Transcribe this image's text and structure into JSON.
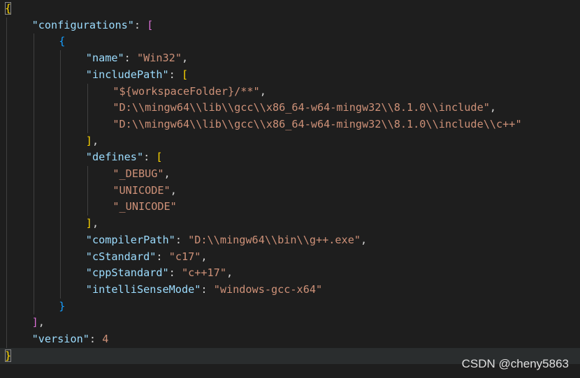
{
  "editor": {
    "lines": [
      {
        "indent": 0,
        "tokens": [
          {
            "t": "{",
            "c": "tok-bracket-y",
            "match": true
          }
        ]
      },
      {
        "indent": 1,
        "tokens": [
          {
            "t": "\"configurations\"",
            "c": "tok-key"
          },
          {
            "t": ": ",
            "c": "tok-punct"
          },
          {
            "t": "[",
            "c": "tok-bracket-p"
          }
        ]
      },
      {
        "indent": 2,
        "tokens": [
          {
            "t": "{",
            "c": "tok-bracket-b"
          }
        ]
      },
      {
        "indent": 3,
        "tokens": [
          {
            "t": "\"name\"",
            "c": "tok-key"
          },
          {
            "t": ": ",
            "c": "tok-punct"
          },
          {
            "t": "\"Win32\"",
            "c": "tok-str"
          },
          {
            "t": ",",
            "c": "tok-punct"
          }
        ]
      },
      {
        "indent": 3,
        "tokens": [
          {
            "t": "\"includePath\"",
            "c": "tok-key"
          },
          {
            "t": ": ",
            "c": "tok-punct"
          },
          {
            "t": "[",
            "c": "tok-bracket-y"
          }
        ]
      },
      {
        "indent": 4,
        "tokens": [
          {
            "t": "\"${workspaceFolder}/**\"",
            "c": "tok-str"
          },
          {
            "t": ",",
            "c": "tok-punct"
          }
        ]
      },
      {
        "indent": 4,
        "tokens": [
          {
            "t": "\"D:\\\\mingw64\\\\lib\\\\gcc\\\\x86_64-w64-mingw32\\\\8.1.0\\\\include\"",
            "c": "tok-str"
          },
          {
            "t": ",",
            "c": "tok-punct"
          }
        ]
      },
      {
        "indent": 4,
        "tokens": [
          {
            "t": "\"D:\\\\mingw64\\\\lib\\\\gcc\\\\x86_64-w64-mingw32\\\\8.1.0\\\\include\\\\c++\"",
            "c": "tok-str"
          }
        ]
      },
      {
        "indent": 3,
        "tokens": [
          {
            "t": "]",
            "c": "tok-bracket-y"
          },
          {
            "t": ",",
            "c": "tok-punct"
          }
        ]
      },
      {
        "indent": 3,
        "tokens": [
          {
            "t": "\"defines\"",
            "c": "tok-key"
          },
          {
            "t": ": ",
            "c": "tok-punct"
          },
          {
            "t": "[",
            "c": "tok-bracket-y"
          }
        ]
      },
      {
        "indent": 4,
        "tokens": [
          {
            "t": "\"_DEBUG\"",
            "c": "tok-str"
          },
          {
            "t": ",",
            "c": "tok-punct"
          }
        ]
      },
      {
        "indent": 4,
        "tokens": [
          {
            "t": "\"UNICODE\"",
            "c": "tok-str"
          },
          {
            "t": ",",
            "c": "tok-punct"
          }
        ]
      },
      {
        "indent": 4,
        "tokens": [
          {
            "t": "\"_UNICODE\"",
            "c": "tok-str"
          }
        ]
      },
      {
        "indent": 3,
        "tokens": [
          {
            "t": "]",
            "c": "tok-bracket-y"
          },
          {
            "t": ",",
            "c": "tok-punct"
          }
        ]
      },
      {
        "indent": 3,
        "tokens": [
          {
            "t": "\"compilerPath\"",
            "c": "tok-key"
          },
          {
            "t": ": ",
            "c": "tok-punct"
          },
          {
            "t": "\"D:\\\\mingw64\\\\bin\\\\g++.exe\"",
            "c": "tok-str"
          },
          {
            "t": ",",
            "c": "tok-punct"
          }
        ]
      },
      {
        "indent": 3,
        "tokens": [
          {
            "t": "\"cStandard\"",
            "c": "tok-key"
          },
          {
            "t": ": ",
            "c": "tok-punct"
          },
          {
            "t": "\"c17\"",
            "c": "tok-str"
          },
          {
            "t": ",",
            "c": "tok-punct"
          }
        ]
      },
      {
        "indent": 3,
        "tokens": [
          {
            "t": "\"cppStandard\"",
            "c": "tok-key"
          },
          {
            "t": ": ",
            "c": "tok-punct"
          },
          {
            "t": "\"c++17\"",
            "c": "tok-str"
          },
          {
            "t": ",",
            "c": "tok-punct"
          }
        ]
      },
      {
        "indent": 3,
        "tokens": [
          {
            "t": "\"intelliSenseMode\"",
            "c": "tok-key"
          },
          {
            "t": ": ",
            "c": "tok-punct"
          },
          {
            "t": "\"windows-gcc-x64\"",
            "c": "tok-str"
          }
        ]
      },
      {
        "indent": 2,
        "tokens": [
          {
            "t": "}",
            "c": "tok-bracket-b"
          }
        ]
      },
      {
        "indent": 1,
        "tokens": [
          {
            "t": "]",
            "c": "tok-bracket-p"
          },
          {
            "t": ",",
            "c": "tok-punct"
          }
        ]
      },
      {
        "indent": 1,
        "tokens": [
          {
            "t": "\"version\"",
            "c": "tok-key"
          },
          {
            "t": ": ",
            "c": "tok-punct"
          },
          {
            "t": "4",
            "c": "tok-num-v"
          }
        ]
      },
      {
        "indent": 0,
        "current": true,
        "tokens": [
          {
            "t": "}",
            "c": "tok-bracket-y",
            "match": true
          }
        ]
      }
    ]
  },
  "watermark": {
    "text": "CSDN @cheny5863"
  },
  "colors": {
    "background": "#1e1e1e",
    "key": "#9cdcfe",
    "string": "#ce9178",
    "bracket_gold": "#ffd700",
    "bracket_purple": "#da70d6",
    "bracket_blue": "#179fff"
  }
}
